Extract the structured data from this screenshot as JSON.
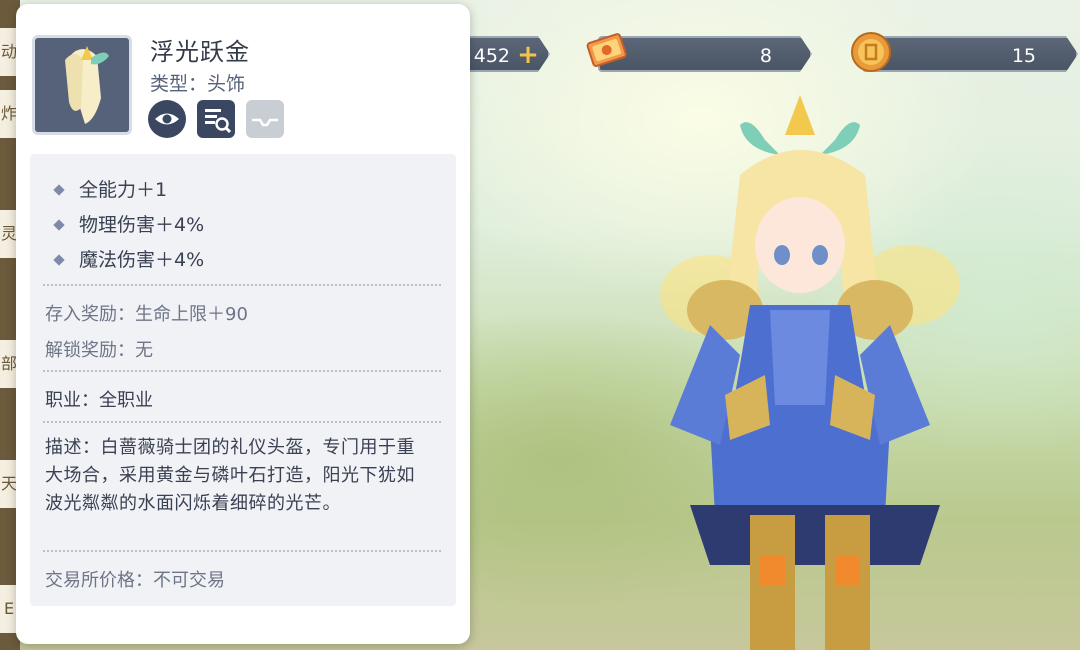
{
  "left_tabs": [
    "动",
    "炸",
    "灵",
    "部",
    "天",
    "E"
  ],
  "currency": {
    "first_value": "452",
    "coupon_value": "8",
    "coin_value": "15"
  },
  "item": {
    "name": "浮光跃金",
    "type": "类型：头饰"
  },
  "stats": [
    "全能力＋1",
    "物理伤害＋4%",
    "魔法伤害＋4%"
  ],
  "deposit_reward": "存入奖励：生命上限＋90",
  "unlock_reward": "解锁奖励：无",
  "profession": "职业：全职业",
  "description": "描述：白蔷薇骑士团的礼仪头盔，专门用于重大场合，采用黄金与磷叶石打造，阳光下犹如波光粼粼的水面闪烁着细碎的光芒。",
  "trade_price": "交易所价格：不可交易",
  "icons": {
    "preview": "eye-icon",
    "inspect": "search-icon",
    "store": "inbox-icon"
  },
  "colors": {
    "panel_bg": "#ffffff",
    "body_bg": "#f1f2f6",
    "icon_dark": "#3b4660",
    "currency_bar": "#4a5566",
    "plus_gold": "#f4c44a"
  }
}
